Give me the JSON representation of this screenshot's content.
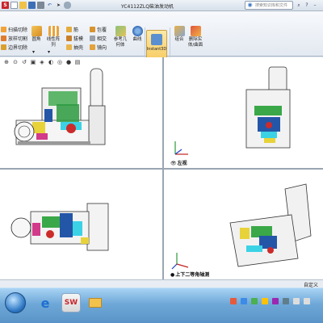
{
  "window": {
    "title": "YC4112ZLQ柴油发动机",
    "search_placeholder": "搜索知识库和文件"
  },
  "quick_access": {
    "icons": [
      "solidworks-logo-icon",
      "new-document-icon",
      "open-folder-icon",
      "save-icon",
      "print-icon",
      "undo-icon",
      "select-arrow-icon",
      "options-icon"
    ]
  },
  "ribbon": {
    "small_left": [
      "扫描切除",
      "放样切割",
      "边界切除"
    ],
    "big_fillet": "圆角",
    "big_linear": "线性阵\n列",
    "mid_small": [
      "筋",
      "拔模",
      "抽壳"
    ],
    "mid_small2": [
      "包覆",
      "相交",
      "镜向"
    ],
    "ref_geometry": "参考几\n何体",
    "curves": "曲线",
    "instant3d": "Instant3D",
    "combine": "组合",
    "delete_body": "删除实\n体/曲面"
  },
  "viewports": {
    "top_right_label": "左视",
    "bottom_right_label": "上下二等角轴测"
  },
  "status": {
    "text": "自定义"
  },
  "taskbar": {
    "apps": [
      "windows-start-orb",
      "internet-explorer-icon",
      "solidworks-taskbar-icon",
      "windows-explorer-icon"
    ]
  }
}
